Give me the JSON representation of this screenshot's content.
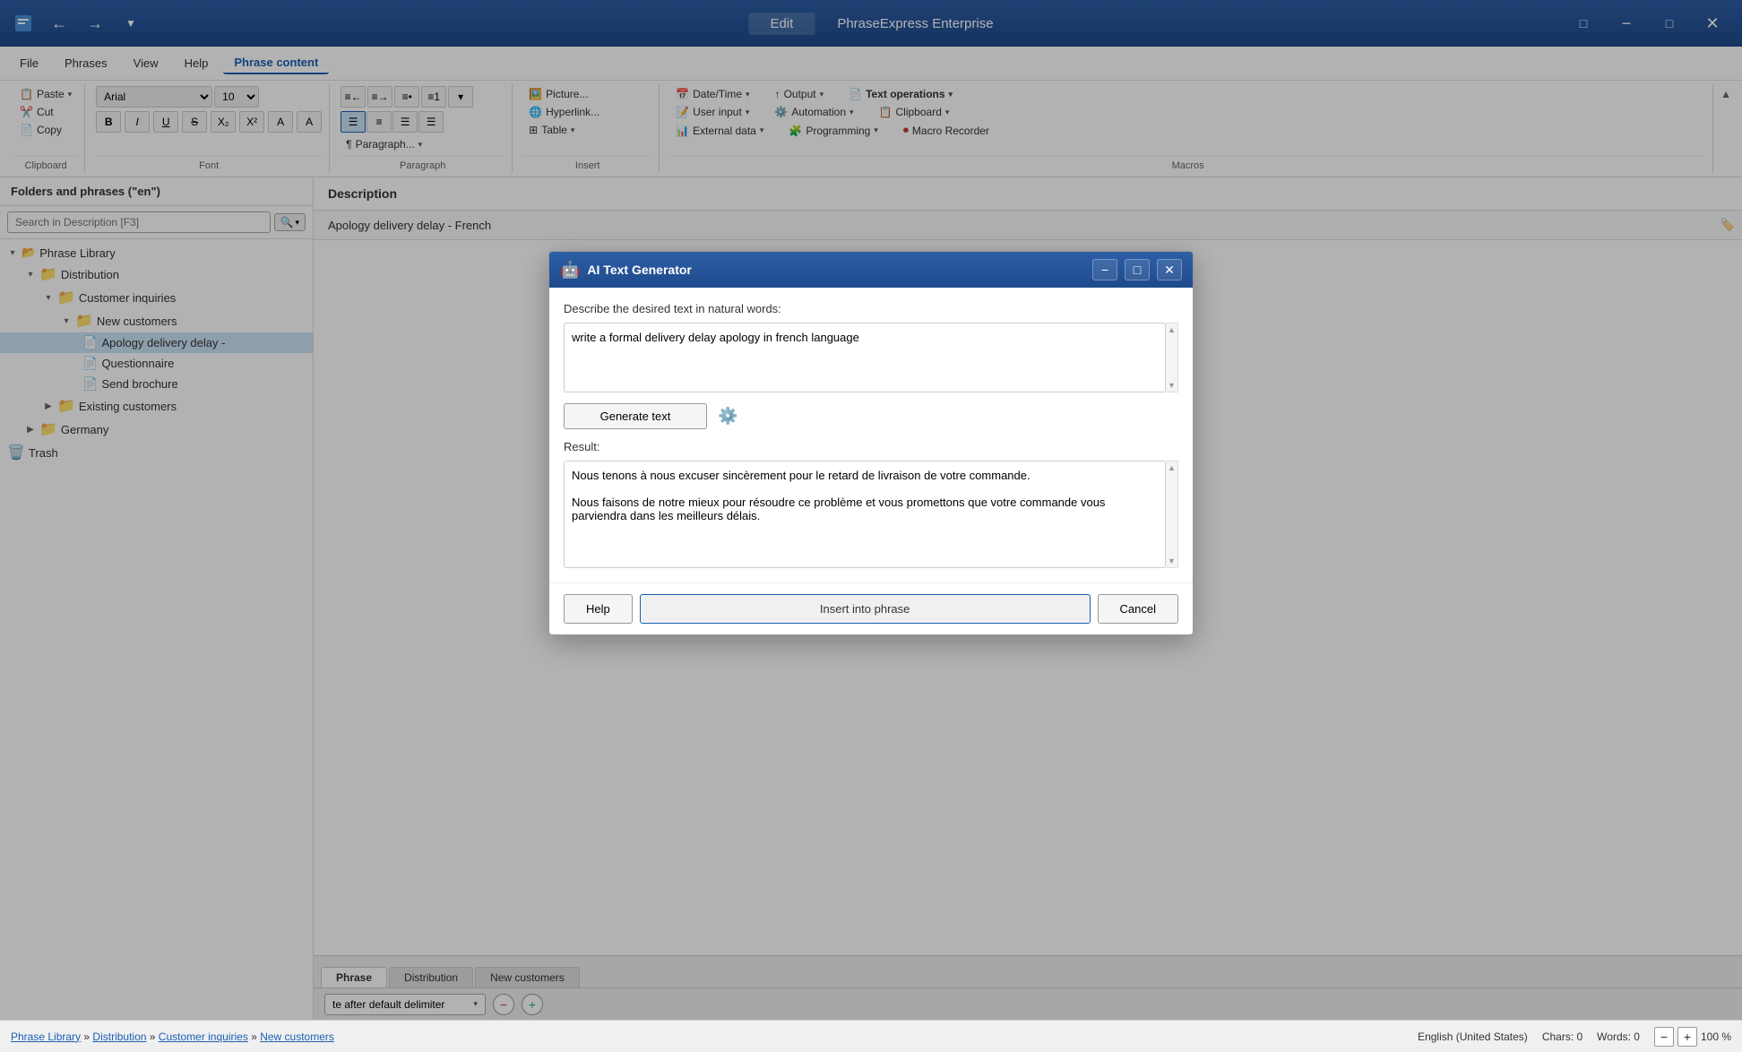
{
  "titlebar": {
    "edit_label": "Edit",
    "app_name": "PhraseExpress Enterprise"
  },
  "menu": {
    "items": [
      "File",
      "Phrases",
      "View",
      "Help",
      "Phrase content"
    ]
  },
  "ribbon": {
    "clipboard_group": "Clipboard",
    "paste_label": "Paste",
    "cut_label": "Cut",
    "copy_label": "Copy",
    "font_group": "Font",
    "font_name": "Arial",
    "font_size": "10",
    "paragraph_group": "Paragraph",
    "insert_group": "Insert",
    "macros_group": "Macros",
    "picture_label": "Picture...",
    "hyperlink_label": "Hyperlink...",
    "table_label": "Table",
    "datetime_label": "Date/Time",
    "userinput_label": "User input",
    "externaldata_label": "External data",
    "output_label": "Output",
    "automation_label": "Automation",
    "programming_label": "Programming",
    "textops_label": "Text operations",
    "clipboard_macro_label": "Clipboard",
    "macrorecorder_label": "Macro Recorder",
    "paragraph_label": "Paragraph..."
  },
  "sidebar": {
    "header": "Folders and phrases (\"en\")",
    "search_placeholder": "Search in Description [F3]",
    "tree": [
      {
        "level": 0,
        "type": "root",
        "label": "Phrase Library",
        "expanded": true
      },
      {
        "level": 1,
        "type": "folder",
        "label": "Distribution",
        "expanded": true
      },
      {
        "level": 2,
        "type": "folder",
        "label": "Customer inquiries",
        "expanded": true
      },
      {
        "level": 3,
        "type": "folder",
        "label": "New customers",
        "expanded": true
      },
      {
        "level": 4,
        "type": "file",
        "label": "Apology delivery delay -",
        "selected": true
      },
      {
        "level": 4,
        "type": "file",
        "label": "Questionnaire"
      },
      {
        "level": 4,
        "type": "file",
        "label": "Send brochure"
      },
      {
        "level": 3,
        "type": "folder",
        "label": "Existing customers",
        "expanded": false
      },
      {
        "level": 2,
        "type": "folder",
        "label": "Germany",
        "expanded": false
      },
      {
        "level": 1,
        "type": "trash",
        "label": "Trash"
      }
    ]
  },
  "description": {
    "header": "Description",
    "value": "Apology delivery delay - French"
  },
  "modal": {
    "title": "AI Text Generator",
    "prompt_label": "Describe the desired text in natural words:",
    "prompt_value": "write a formal delivery delay apology in french language",
    "generate_btn": "Generate text",
    "result_label": "Result:",
    "result_text": "Nous tenons à nous excuser sincèrement pour le retard de livraison de votre commande.\n\nNous faisons de notre mieux pour résoudre ce problème et vous promettons que votre commande vous parviendra dans les meilleurs délais.",
    "help_btn": "Help",
    "insert_btn": "Insert into phrase",
    "cancel_btn": "Cancel"
  },
  "statusbar": {
    "breadcrumb": [
      "Phrase Library",
      "Distribution",
      "Customer inquiries",
      "New customers"
    ],
    "locale": "English (United States)",
    "chars": "Chars: 0",
    "words": "Words: 0",
    "insert_label": "te after default delimiter",
    "zoom": "100 %"
  },
  "bottom_tabs": [
    {
      "label": "Phrase",
      "active": true
    },
    {
      "label": "Distribution"
    },
    {
      "label": "New customers"
    }
  ],
  "insert_bar": {
    "dropdown_label": "te after default delimiter"
  }
}
